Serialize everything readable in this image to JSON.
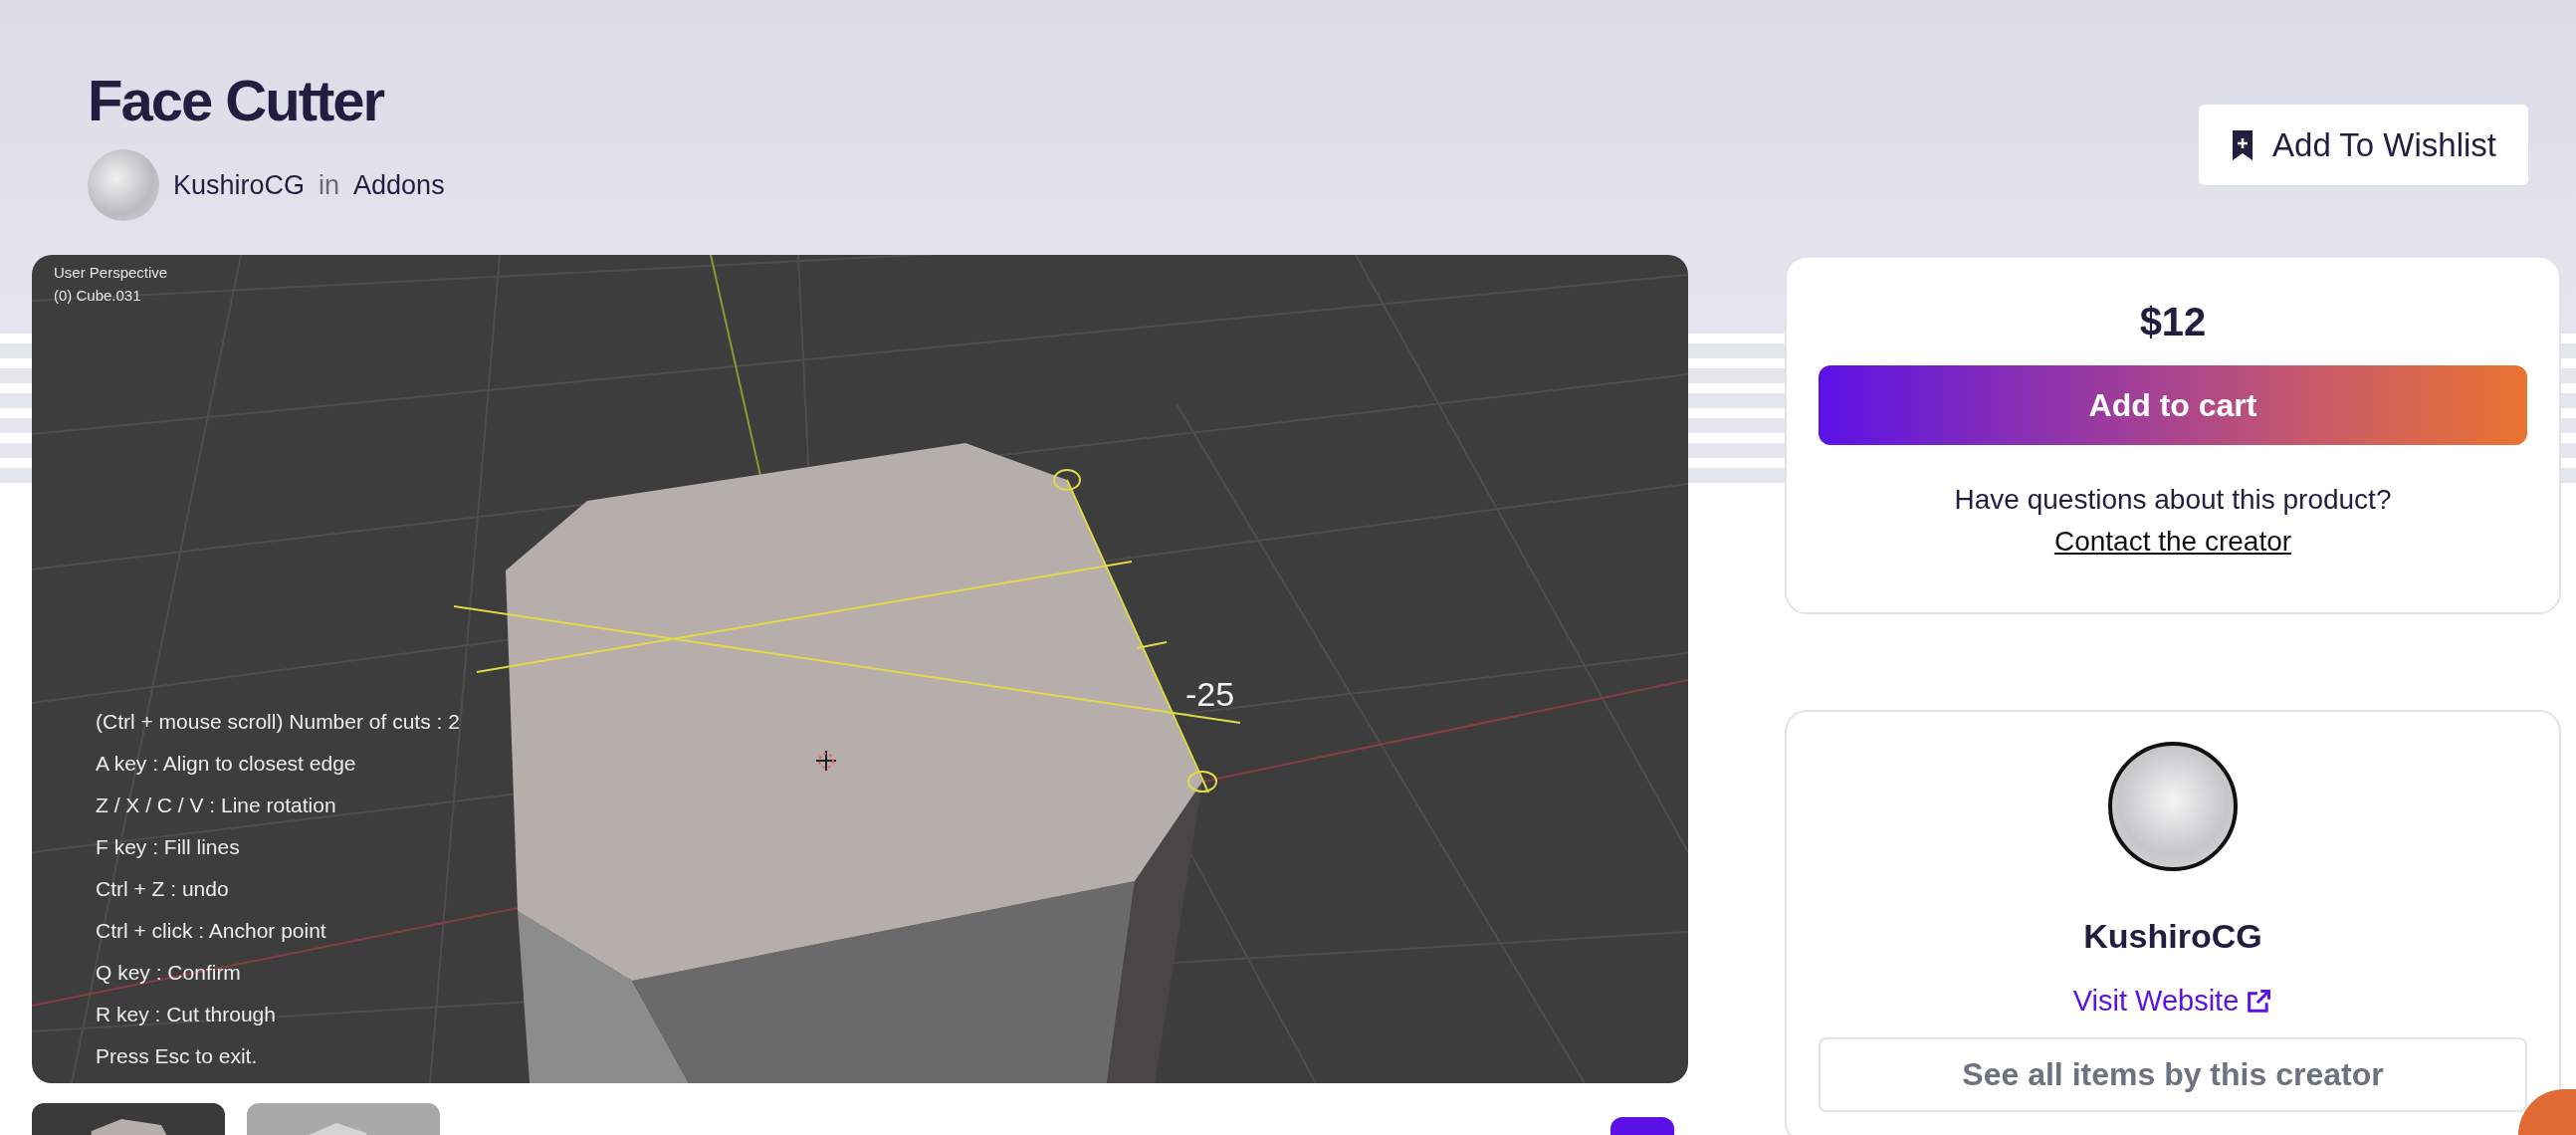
{
  "header": {
    "title": "Face Cutter",
    "author": "KushiroCG",
    "connector": "in",
    "category": "Addons"
  },
  "wishlist_button": {
    "label": "Add To Wishlist"
  },
  "gallery": {
    "viewport": {
      "view_name": "User Perspective",
      "object_name": "(0) Cube.031",
      "angle_reading": "-25",
      "hints": [
        "(Ctrl + mouse scroll) Number of cuts : 2",
        "A key : Align to closest edge",
        "Z / X / C / V : Line rotation",
        "F key : Fill lines",
        "Ctrl + Z : undo",
        "Ctrl + click : Anchor point",
        "Q key : Confirm",
        "R key : Cut through",
        "Press Esc to exit."
      ]
    },
    "thumbnails": [
      {
        "kind": "dark"
      },
      {
        "kind": "light"
      }
    ]
  },
  "purchase": {
    "price": "$12",
    "cart_button": "Add to cart",
    "question": "Have questions about this product?",
    "contact_link": "Contact the creator"
  },
  "creator": {
    "name": "KushiroCG",
    "website_link": "Visit Website",
    "all_items_button": "See all items by this creator"
  }
}
